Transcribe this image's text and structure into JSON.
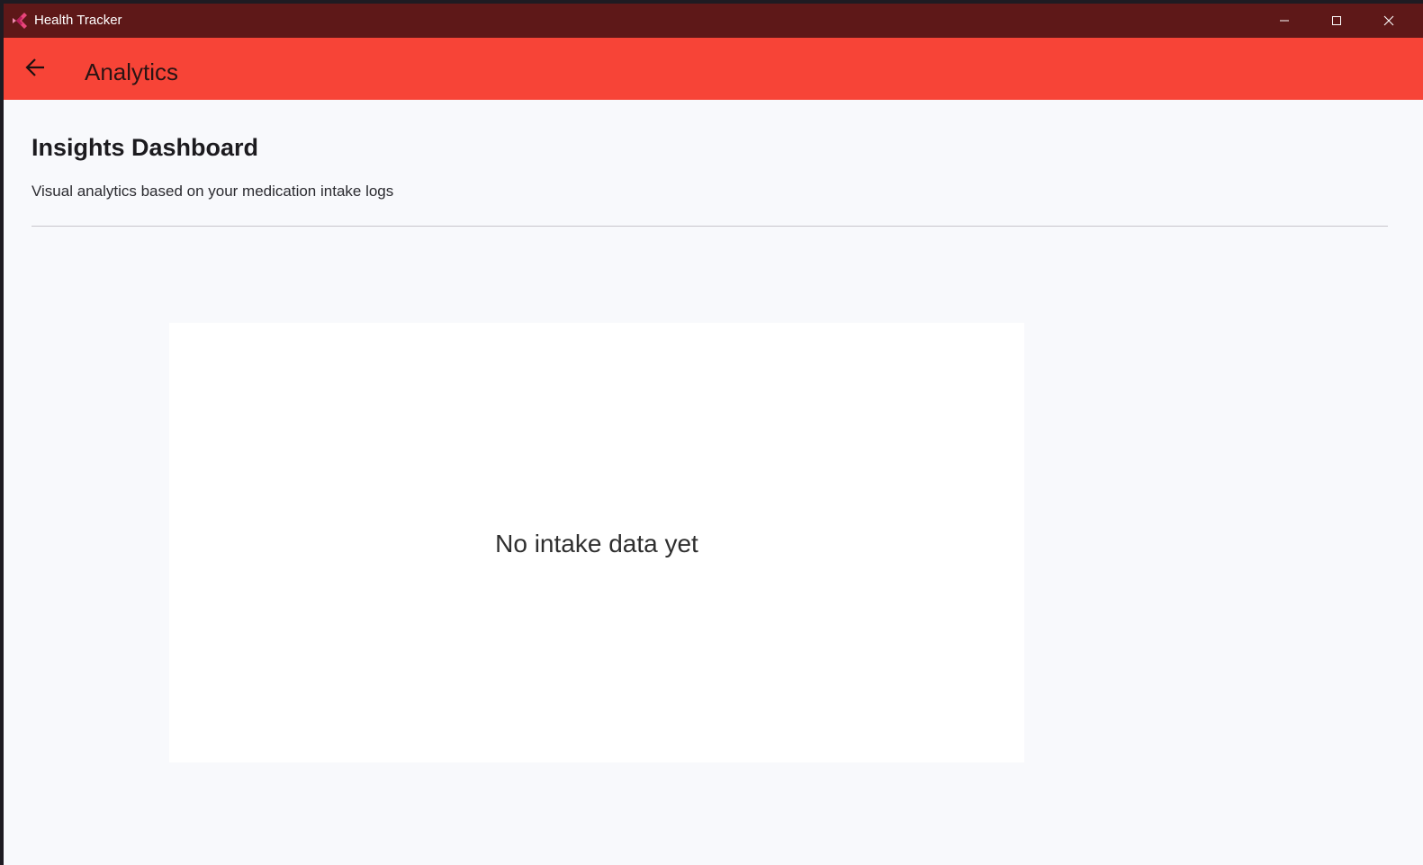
{
  "window": {
    "title": "Health Tracker",
    "controls": {
      "minimize_icon": "minimize-icon",
      "maximize_icon": "maximize-icon",
      "close_icon": "close-icon"
    }
  },
  "appbar": {
    "back_icon": "arrow-left-icon",
    "title": "Analytics",
    "color": "#f74437"
  },
  "content": {
    "title": "Insights Dashboard",
    "subtitle": "Visual analytics based on your medication intake logs",
    "chart_empty_message": "No intake data yet"
  },
  "colors": {
    "titlebar": "#5e1818",
    "background": "#f8f9fc",
    "card": "#ffffff"
  }
}
